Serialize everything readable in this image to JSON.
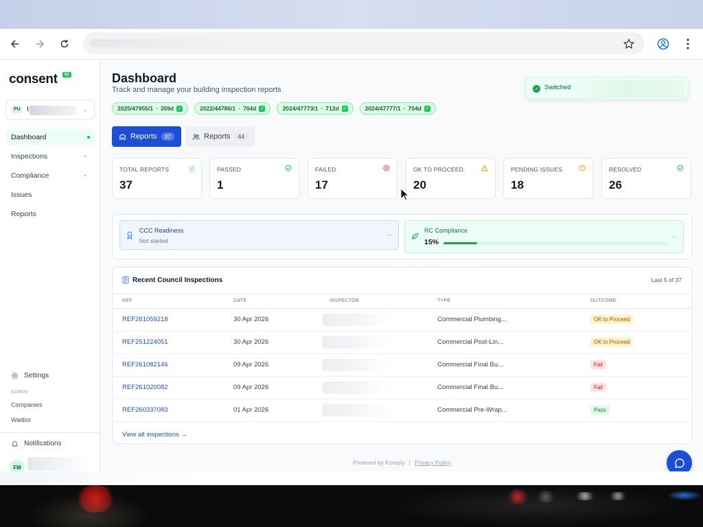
{
  "app": {
    "logo": "consent",
    "logo_badge": "NZ",
    "org_badge": "PU",
    "org_initial": "I"
  },
  "sidebar": {
    "items": [
      {
        "label": "Dashboard"
      },
      {
        "label": "Inspections"
      },
      {
        "label": "Compliance"
      },
      {
        "label": "Issues"
      },
      {
        "label": "Reports"
      }
    ],
    "settings": "Settings",
    "admin_heading": "ADMIN",
    "admin_links": [
      "Companies",
      "Waitlist"
    ],
    "notifications": "Notifications",
    "avatar": "FM"
  },
  "header": {
    "title": "Dashboard",
    "subtitle": "Track and manage your building inspection reports"
  },
  "consents": [
    {
      "ref": "2025/47955/1",
      "days": "359d"
    },
    {
      "ref": "2022/44786/1",
      "days": "704d"
    },
    {
      "ref": "2024/47773/1",
      "days": "712d"
    },
    {
      "ref": "2024/47777/1",
      "days": "704d"
    }
  ],
  "toast": {
    "text": "Switched"
  },
  "tabs": [
    {
      "label": "Reports",
      "count": "37"
    },
    {
      "label": "Reports",
      "count": "44"
    }
  ],
  "stats": [
    {
      "label": "TOTAL REPORTS",
      "value": "37",
      "icon": "document-icon",
      "color": "#3b82f6"
    },
    {
      "label": "PASSED",
      "value": "1",
      "icon": "check-circle-icon",
      "color": "#22c55e"
    },
    {
      "label": "FAILED",
      "value": "17",
      "icon": "x-circle-icon",
      "color": "#ef4444"
    },
    {
      "label": "OK TO PROCEED",
      "value": "20",
      "icon": "warning-icon",
      "color": "#f59e0b"
    },
    {
      "label": "PENDING ISSUES",
      "value": "18",
      "icon": "info-icon",
      "color": "#f59e0b"
    },
    {
      "label": "RESOLVED",
      "value": "26",
      "icon": "check-circle-icon",
      "color": "#22c55e"
    }
  ],
  "readiness": {
    "ccc_title": "CCC Readiness",
    "ccc_status": "Not started",
    "rc_title": "RC Compliance",
    "rc_percent": "15%",
    "rc_progress": 0.15
  },
  "inspections": {
    "title": "Recent Council Inspections",
    "meta": "Last 5 of 37",
    "columns": [
      "REF",
      "DATE",
      "INSPECTOR",
      "TYPE",
      "OUTCOME"
    ],
    "rows": [
      {
        "ref": "REF261059218",
        "date": "30 Apr 2026",
        "type": "Commercial Plumbing...",
        "outcome": "OK to Proceed",
        "status": "ok"
      },
      {
        "ref": "REF251224051",
        "date": "30 Apr 2026",
        "type": "Commercial Post-Lin...",
        "outcome": "OK to Proceed",
        "status": "ok"
      },
      {
        "ref": "REF261082146",
        "date": "09 Apr 2026",
        "type": "Commercial Final Bu...",
        "outcome": "Fail",
        "status": "fail"
      },
      {
        "ref": "REF261020082",
        "date": "09 Apr 2026",
        "type": "Commercial Final Bu...",
        "outcome": "Fail",
        "status": "fail"
      },
      {
        "ref": "REF260337083",
        "date": "01 Apr 2026",
        "type": "Commercial Pre-Wrap...",
        "outcome": "Pass",
        "status": "pass"
      }
    ],
    "view_all": "View all inspections →"
  },
  "footer": {
    "powered": "Powered by Komply",
    "separator": "|",
    "privacy": "Privacy Policy"
  },
  "colors": {
    "primary": "#1d4ed8",
    "accent_green": "#10b981",
    "ok_bg": "#fef3c7",
    "ok_fg": "#b45309",
    "fail_bg": "#fee2e2",
    "fail_fg": "#b91c1c",
    "pass_bg": "#dcfce7",
    "pass_fg": "#15803d"
  }
}
